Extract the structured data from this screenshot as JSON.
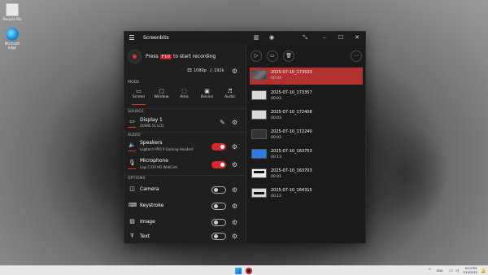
{
  "desktop": {
    "icons": [
      {
        "label": "Recycle Bin",
        "icon": "recycle-bin-icon"
      },
      {
        "label": "Microsoft Edge",
        "icon": "edge-icon"
      }
    ]
  },
  "app": {
    "title": "Screenbits",
    "titlebar_icons": [
      "menu-icon",
      "bookmarks-icon",
      "eye-icon",
      "compact-icon",
      "minimize-icon",
      "maximize-icon",
      "close-icon"
    ],
    "record": {
      "prefix": "Press",
      "key": "F10",
      "suffix": "to start recording"
    },
    "quality": {
      "resolution": "1080p",
      "audio": "192k"
    },
    "mode_header": "MODE",
    "modes": [
      {
        "label": "Screen",
        "icon": "monitor-icon",
        "active": true
      },
      {
        "label": "Window",
        "icon": "window-icon",
        "active": false
      },
      {
        "label": "Area",
        "icon": "area-icon",
        "active": false
      },
      {
        "label": "Device",
        "icon": "device-icon",
        "active": false
      },
      {
        "label": "Audio",
        "icon": "audio-icon",
        "active": false
      }
    ],
    "source_header": "SOURCE",
    "source": {
      "title": "Display 1",
      "subtitle": "ZOWIE XL LCD"
    },
    "audio_header": "AUDIO",
    "audio": [
      {
        "title": "Speakers",
        "subtitle": "Logitech PRO X Gaming Headset",
        "on": true,
        "icon": "speaker-icon"
      },
      {
        "title": "Microphone",
        "subtitle": "Logi C310 HD WebCam",
        "on": true,
        "icon": "microphone-icon"
      }
    ],
    "options_header": "OPTIONS",
    "options": [
      {
        "title": "Camera",
        "on": false,
        "icon": "camera-icon"
      },
      {
        "title": "Keystroke",
        "on": false,
        "icon": "keyboard-icon"
      },
      {
        "title": "Image",
        "on": false,
        "icon": "image-icon"
      },
      {
        "title": "Text",
        "on": false,
        "icon": "text-icon"
      }
    ],
    "recordings": [
      {
        "name": "2025-07-10_173533",
        "duration": "00:04",
        "selected": true,
        "thumb": "photo"
      },
      {
        "name": "2025-07-10_173357",
        "duration": "00:03",
        "selected": false,
        "thumb": "light"
      },
      {
        "name": "2025-07-10_172408",
        "duration": "00:03",
        "selected": false,
        "thumb": "light"
      },
      {
        "name": "2025-07-10_172240",
        "duration": "00:02",
        "selected": false,
        "thumb": "dark"
      },
      {
        "name": "2025-07-10_163753",
        "duration": "00:13",
        "selected": false,
        "thumb": "blue"
      },
      {
        "name": "2025-07-10_163703",
        "duration": "00:01",
        "selected": false,
        "thumb": "light"
      },
      {
        "name": "2025-07-10_164315",
        "duration": "00:12",
        "selected": false,
        "thumb": "light"
      }
    ]
  },
  "taskbar": {
    "language": "ENG",
    "time": "6:03 PM",
    "date": "7/10/2025"
  },
  "colors": {
    "accent": "#d8282e",
    "selected_row": "#b0312f",
    "window_bg": "#1c1c1c"
  }
}
